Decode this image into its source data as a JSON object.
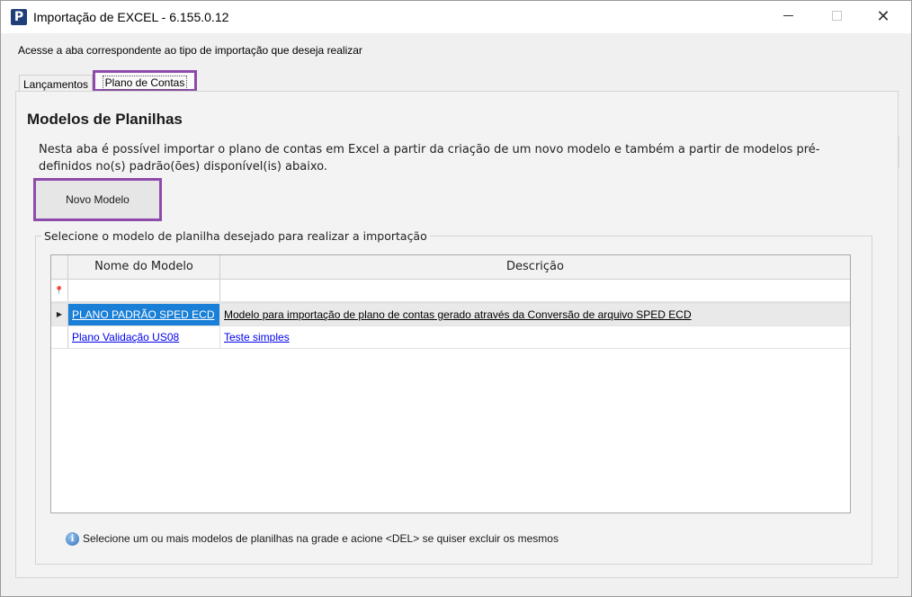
{
  "window": {
    "title": "Importação de EXCEL - 6.155.0.12",
    "app_icon": "P"
  },
  "instruction": "Acesse a aba correspondente ao tipo de importação que deseja realizar",
  "tabs": [
    {
      "label": "Lançamentos",
      "active": false
    },
    {
      "label": "Plano de Contas",
      "active": true
    }
  ],
  "panel": {
    "title": "Modelos de Planilhas",
    "description": "Nesta aba é possível importar o plano de contas em Excel a partir da criação de um novo modelo e também a partir de modelos pré-definidos no(s) padrão(ões) disponível(is) abaixo.",
    "new_model_button": "Novo Modelo",
    "group_label": "Selecione o modelo de planilha desejado para realizar a importação",
    "grid": {
      "columns": [
        "Nome do Modelo",
        "Descrição"
      ],
      "rows": [
        {
          "nome": "PLANO PADRÃO SPED ECD",
          "descricao": "Modelo para importação de plano de contas gerado através da Conversão de arquivo SPED ECD",
          "selected": true
        },
        {
          "nome": "Plano Validação US08",
          "descricao": "Teste simples",
          "selected": false
        }
      ]
    },
    "info_text": "Selecione um ou mais modelos de planilhas na grade e acione <DEL> se quiser excluir os mesmos"
  },
  "colors": {
    "highlight_border": "#8f4bab",
    "selected_cell": "#1a7fd6",
    "link": "#0000ee"
  },
  "icons": [
    "app-logo-icon",
    "minimize-icon",
    "maximize-icon",
    "close-icon",
    "filter-pin-icon",
    "row-pointer-icon",
    "info-icon"
  ]
}
